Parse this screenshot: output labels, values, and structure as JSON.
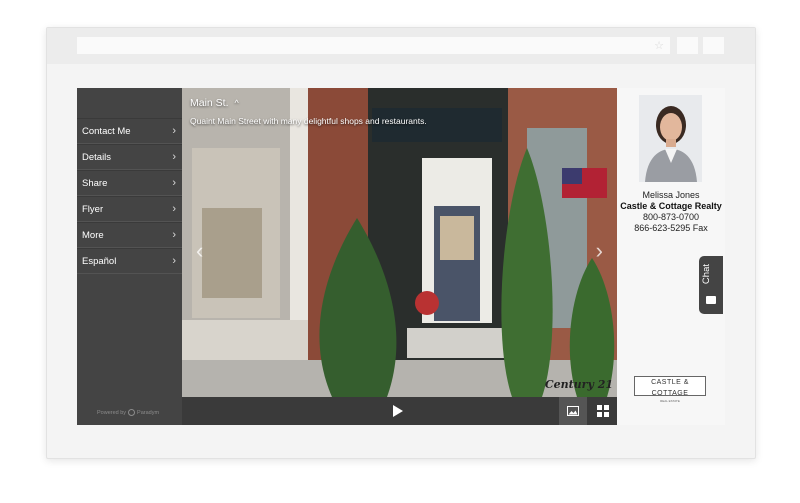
{
  "sidebar": {
    "items": [
      {
        "label": "Contact Me"
      },
      {
        "label": "Details"
      },
      {
        "label": "Share"
      },
      {
        "label": "Flyer"
      },
      {
        "label": "More"
      },
      {
        "label": "Español"
      }
    ],
    "powered_by": "Powered by",
    "powered_brand": "Paradym"
  },
  "photo": {
    "title": "Main St.",
    "caption": "Quaint Main Street with many delightful shops and restaurants.",
    "watermark": "Century 21"
  },
  "agent": {
    "name": "Melissa Jones",
    "company": "Castle & Cottage Realty",
    "phone": "800-873-0700",
    "fax": "866-623-5295 Fax",
    "brand_main": "CASTLE & COTTAGE",
    "brand_sub": "REAL ESTATE"
  },
  "chat": {
    "label": "Chat"
  },
  "icons": {
    "chevron": "chevron-right-icon",
    "play": "play-icon",
    "photo": "photo-icon",
    "grid": "grid-icon"
  }
}
